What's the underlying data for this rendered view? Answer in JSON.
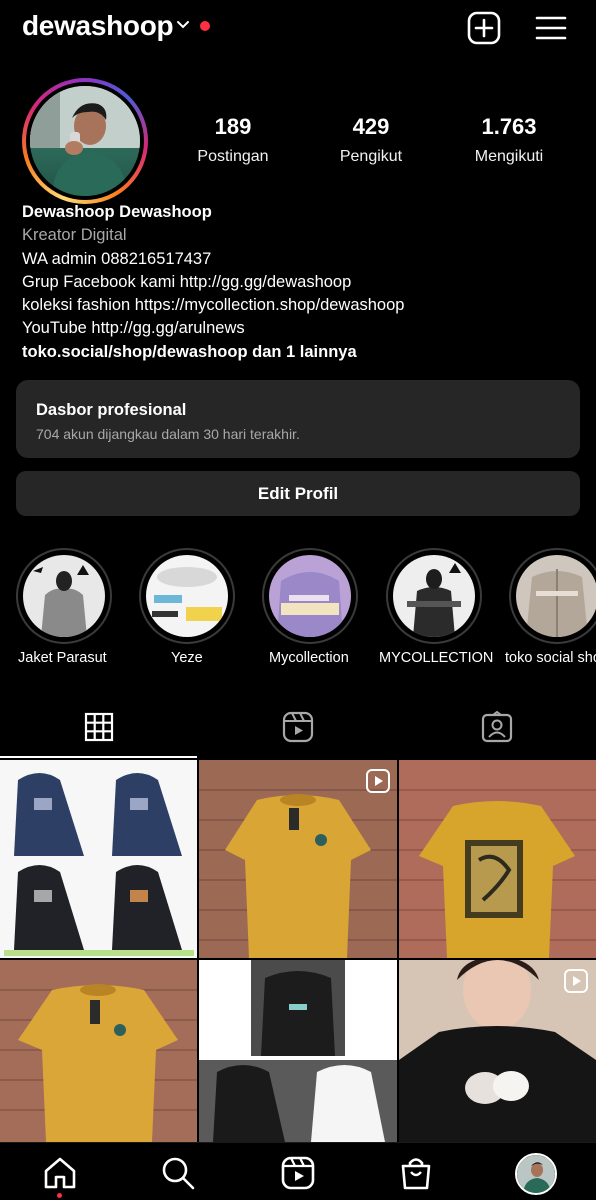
{
  "header": {
    "username": "dewashoop",
    "icons": {
      "dropdown": "chevron-down-icon",
      "create": "plus-square-icon",
      "menu": "hamburger-menu-icon"
    },
    "notification_dot_color": "#ff3040"
  },
  "profile": {
    "stats": [
      {
        "value": "189",
        "label": "Postingan"
      },
      {
        "value": "429",
        "label": "Pengikut"
      },
      {
        "value": "1.763",
        "label": "Mengikuti"
      }
    ],
    "name": "Dewashoop Dewashoop",
    "category": "Kreator Digital",
    "bio_lines": [
      "WA admin 088216517437",
      "Grup Facebook kami http://gg.gg/dewashoop",
      "koleksi fashion https://mycollection.shop/dewashoop",
      "YouTube http://gg.gg/arulnews"
    ],
    "links": "toko.social/shop/dewashoop dan 1 lainnya"
  },
  "dashboard": {
    "title": "Dasbor profesional",
    "subtitle": "704 akun dijangkau dalam 30 hari terakhir."
  },
  "edit_profile_label": "Edit Profil",
  "highlights": [
    {
      "label": "Jaket Parasut"
    },
    {
      "label": "Yeze"
    },
    {
      "label": "Mycollection"
    },
    {
      "label": "MYCOLLECTION"
    },
    {
      "label": "toko social shop"
    }
  ],
  "tabs": [
    {
      "icon": "grid-icon",
      "active": true
    },
    {
      "icon": "reels-icon",
      "active": false
    },
    {
      "icon": "tagged-icon",
      "active": false
    }
  ],
  "grid_posts": [
    {
      "subject": "navy and black zip hoodies"
    },
    {
      "subject": "mustard t-shirt",
      "reel": true
    },
    {
      "subject": "mustard graphic t-shirt"
    },
    {
      "subject": "mustard t-shirt"
    },
    {
      "subject": "black and white hoodies"
    },
    {
      "subject": "black t-shirt with bears",
      "reel": true
    }
  ],
  "bottom_nav": [
    {
      "icon": "home-icon"
    },
    {
      "icon": "search-icon"
    },
    {
      "icon": "reels-icon"
    },
    {
      "icon": "shop-bag-icon"
    },
    {
      "icon": "profile-avatar-icon"
    }
  ],
  "colors": {
    "background": "#000000",
    "surface": "#262626",
    "muted_text": "#a8a8a8",
    "accent_red": "#ff3040",
    "mustard": "#d9a535"
  }
}
